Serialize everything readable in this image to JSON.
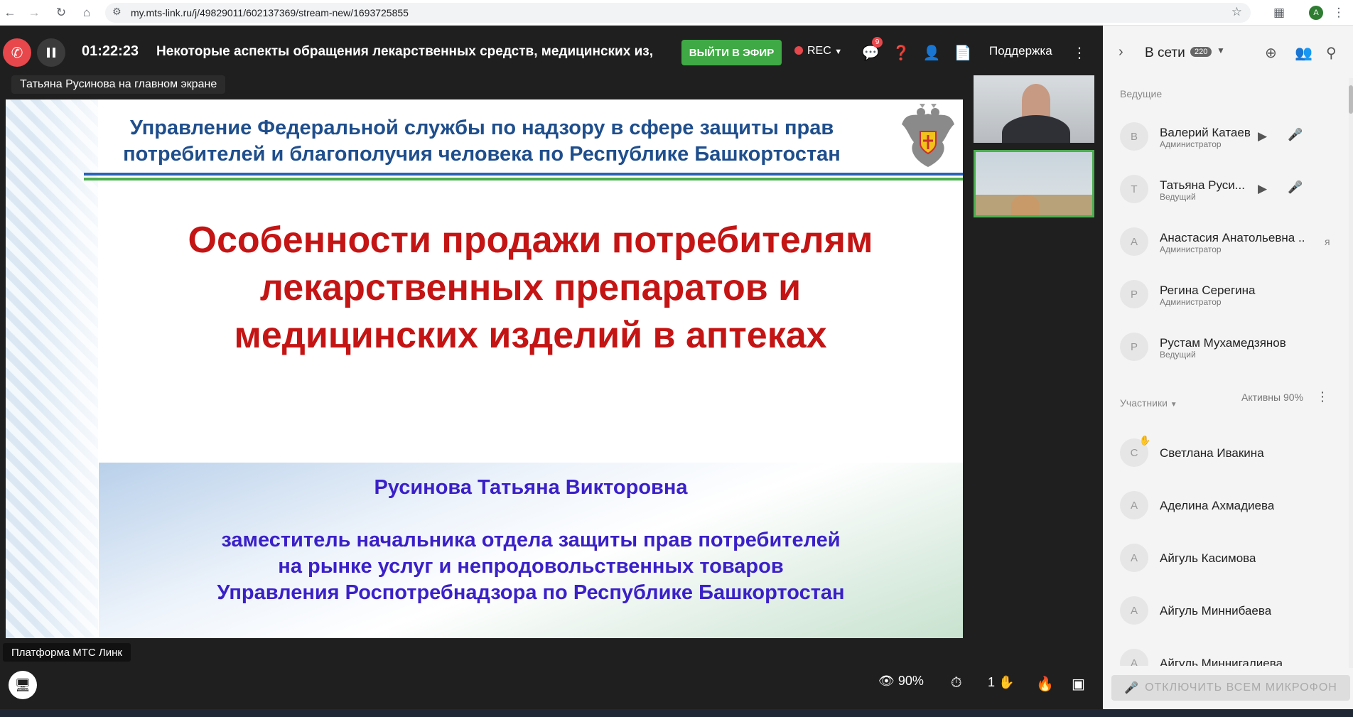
{
  "browser": {
    "url": "my.mts-link.ru/j/49829011/602137369/stream-new/1693725855",
    "profile_initial": "A",
    "icons": [
      "back-icon",
      "forward-icon",
      "reload-icon",
      "home-icon",
      "tune-icon",
      "star-icon",
      "extensions-icon"
    ]
  },
  "topbar": {
    "timer": "01:22:23",
    "event_title": "Некоторые аспекты обращения лекарственных средств, медицинских из,",
    "go_live_label": "ВЫЙТИ В ЭФИР",
    "rec_label": "REC",
    "chat_badge": "9",
    "support_label": "Поддержка",
    "colors": {
      "end_call": "#e8474b",
      "go_live": "#3fa945"
    }
  },
  "stage": {
    "on_screen_label": "Татьяна Русинова на главном экране",
    "slide": {
      "header": [
        "Управление Федеральной службы по надзору в сфере защиты прав",
        "потребителей и благополучия человека по Республике Башкортостан"
      ],
      "title": [
        "Особенности продажи потребителям",
        "лекарственных препаратов и",
        "медицинских изделий в аптеках"
      ],
      "speaker_name": "Русинова Татьяна Викторовна",
      "speaker_role": [
        "заместитель начальника отдела защиты прав потребителей",
        "на рынке услуг и непродовольственных товаров",
        "Управления Роспотребнадзора по Республике Башкортостан"
      ],
      "colors": {
        "header": "#1f4e8c",
        "title": "#c41414",
        "speaker": "#3a20c8"
      }
    }
  },
  "bottombar": {
    "platform_tooltip": "Платформа МТС Линк",
    "viewers_percent": "90%",
    "hands_count": "1"
  },
  "sidebar": {
    "online_label": "В сети",
    "online_count": "220",
    "hosts_label": "Ведущие",
    "hosts": [
      {
        "initial": "В",
        "name": "Валерий Катаев",
        "role": "Администратор",
        "video": true,
        "mic": true
      },
      {
        "initial": "Т",
        "name": "Татьяна Руси...",
        "role": "Ведущий",
        "video": true,
        "mic": true
      },
      {
        "initial": "А",
        "name": "Анастасия Анатольевна ...",
        "role": "Администратор",
        "extra": "я"
      },
      {
        "initial": "Р",
        "name": "Регина Серегина",
        "role": "Администратор"
      },
      {
        "initial": "Р",
        "name": "Рустам Мухамедзянов",
        "role": "Ведущий"
      }
    ],
    "participants_label": "Участники",
    "active_label": "Активны 90%",
    "participants": [
      {
        "initial": "С",
        "name": "Светлана Ивакина",
        "hand": true
      },
      {
        "initial": "А",
        "name": "Аделина Ахмадиева"
      },
      {
        "initial": "А",
        "name": "Айгуль Касимова"
      },
      {
        "initial": "А",
        "name": "Айгуль Миннибаева"
      },
      {
        "initial": "А",
        "name": "Айгуль Миннигалиева"
      }
    ],
    "mute_all_label": "ОТКЛЮЧИТЬ ВСЕМ МИКРОФОН"
  }
}
